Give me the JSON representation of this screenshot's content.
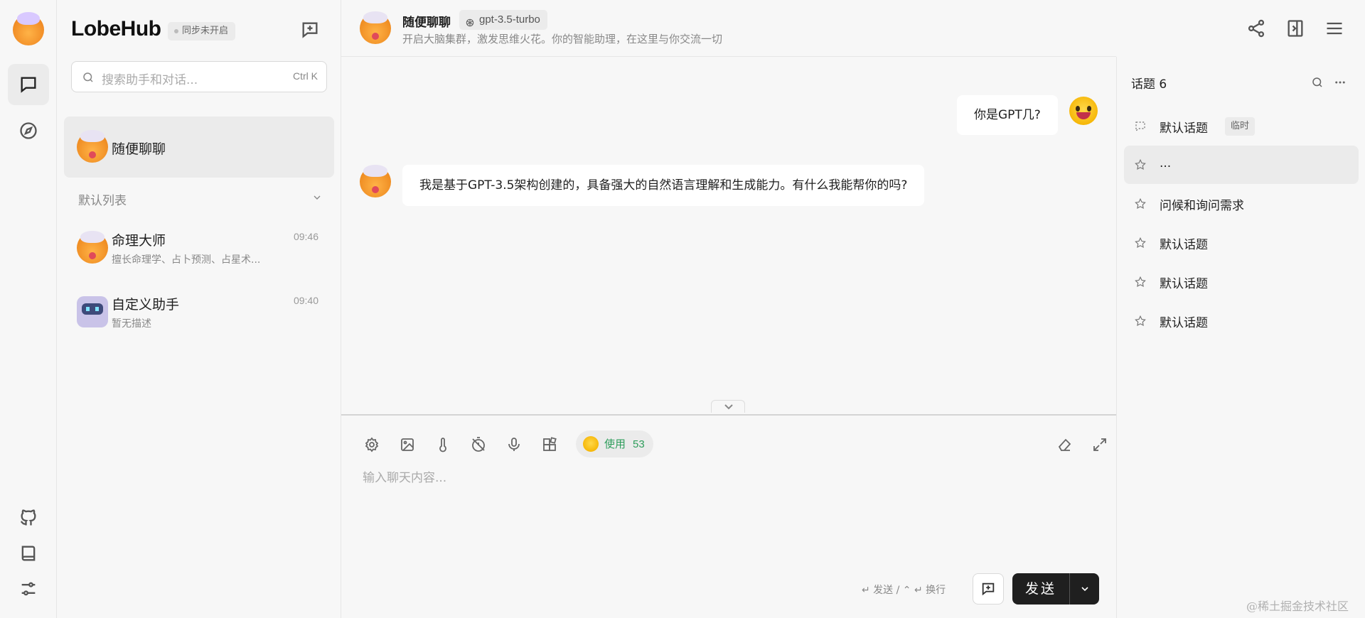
{
  "rail": {
    "nav": [
      {
        "name": "chat",
        "icon": "chat-bubble-icon",
        "active": true
      },
      {
        "name": "discover",
        "icon": "compass-icon",
        "active": false
      }
    ],
    "bottom": [
      {
        "name": "github",
        "icon": "github-icon"
      },
      {
        "name": "docs",
        "icon": "book-icon"
      },
      {
        "name": "settings",
        "icon": "sliders-icon"
      }
    ]
  },
  "sidebar": {
    "brand": "LobeHub",
    "sync_status": "同步未开启",
    "search": {
      "placeholder": "搜索助手和对话...",
      "shortcut": "Ctrl K"
    },
    "inbox": {
      "title": "随便聊聊"
    },
    "group_title": "默认列表",
    "sessions": [
      {
        "title": "命理大师",
        "desc": "擅长命理学、占卜预测、占星术...",
        "time": "09:46",
        "avatar": "owl"
      },
      {
        "title": "自定义助手",
        "desc": "暂无描述",
        "time": "09:40",
        "avatar": "robot"
      }
    ]
  },
  "chat": {
    "title": "随便聊聊",
    "model": "gpt-3.5-turbo",
    "description": "开启大脑集群，激发思维火花。你的智能助理，在这里与你交流一切",
    "messages": [
      {
        "role": "user",
        "text": "你是GPT几?"
      },
      {
        "role": "assistant",
        "text": "我是基于GPT-3.5架构创建的，具备强大的自然语言理解和生成能力。有什么我能帮你的吗?"
      }
    ],
    "input": {
      "placeholder": "输入聊天内容...",
      "usage_label": "使用",
      "usage_count": "53",
      "hint": "↵ 发送 / ⌃ ↵ 换行",
      "send_label": "发送"
    }
  },
  "topics": {
    "title": "话题 6",
    "items": [
      {
        "label": "默认话题",
        "tag": "临时",
        "icon": "dashed-chat-icon",
        "active": false
      },
      {
        "label": "...",
        "icon": "star-icon",
        "active": true
      },
      {
        "label": "问候和询问需求",
        "icon": "star-icon",
        "active": false
      },
      {
        "label": "默认话题",
        "icon": "star-icon",
        "active": false
      },
      {
        "label": "默认话题",
        "icon": "star-icon",
        "active": false
      },
      {
        "label": "默认话题",
        "icon": "star-icon",
        "active": false
      }
    ]
  },
  "watermark": "@稀土掘金技术社区",
  "colors": {
    "accent": "#1f1f1f",
    "usage_green": "#2e9d5b",
    "background": "#f7f7f7",
    "bubble": "#ffffff"
  }
}
